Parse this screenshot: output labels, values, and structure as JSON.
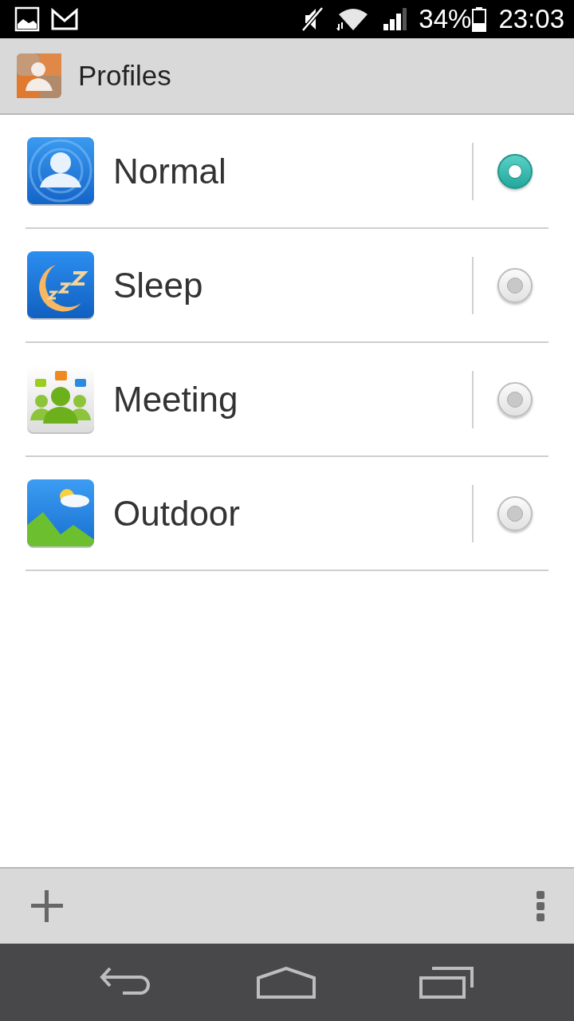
{
  "status_bar": {
    "battery": "34%",
    "time": "23:03"
  },
  "app_bar": {
    "title": "Profiles"
  },
  "profiles": [
    {
      "kind": "normal",
      "name": "Normal",
      "selected": true
    },
    {
      "kind": "sleep",
      "name": "Sleep",
      "selected": false
    },
    {
      "kind": "meeting",
      "name": "Meeting",
      "selected": false
    },
    {
      "kind": "outdoor",
      "name": "Outdoor",
      "selected": false
    }
  ]
}
